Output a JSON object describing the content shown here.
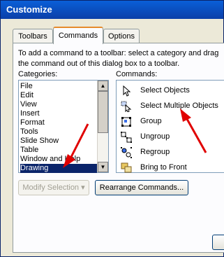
{
  "window": {
    "title": "Customize"
  },
  "tabs": [
    {
      "label": "Toolbars"
    },
    {
      "label": "Commands"
    },
    {
      "label": "Options"
    }
  ],
  "description": "To add a command to a toolbar: select a category and drag the command out of this dialog box to a toolbar.",
  "categories": {
    "label": "Categories:",
    "items": [
      "File",
      "Edit",
      "View",
      "Insert",
      "Format",
      "Tools",
      "Slide Show",
      "Table",
      "Window and Help",
      "Drawing"
    ],
    "selected": "Drawing"
  },
  "commands": {
    "label": "Commands:",
    "items": [
      {
        "label": "Select Objects",
        "icon": "pointer-arrow-icon"
      },
      {
        "label": "Select Multiple Objects",
        "icon": "select-multiple-icon"
      },
      {
        "label": "Group",
        "icon": "group-icon"
      },
      {
        "label": "Ungroup",
        "icon": "ungroup-icon"
      },
      {
        "label": "Regroup",
        "icon": "regroup-icon"
      },
      {
        "label": "Bring to Front",
        "icon": "bring-to-front-icon"
      }
    ]
  },
  "buttons": {
    "modify_selection": "Modify Selection ▾",
    "rearrange_commands": "Rearrange Commands..."
  },
  "colors": {
    "titlebar": "#0a5fd8",
    "selection": "#0a246a",
    "annotation_arrow": "#e00000"
  }
}
